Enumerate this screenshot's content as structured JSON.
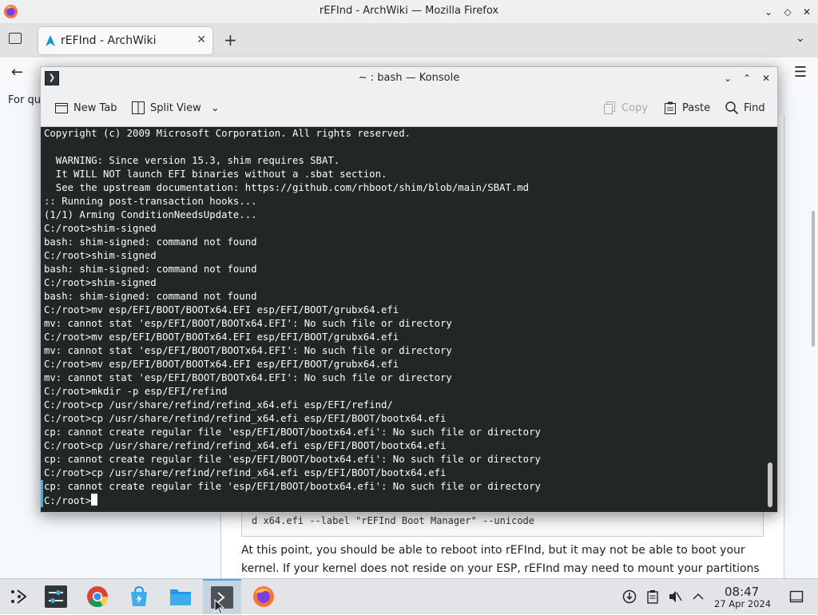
{
  "firefox": {
    "window_title": "rEFInd - ArchWiki — Mozilla Firefox",
    "tab_label": "rEFInd - ArchWiki",
    "notice_fragment": "For qu",
    "code_fragment": "d x64.efi --label \"rEFInd Boot Manager\" --unicode",
    "paragraph": "At this point, you should be able to reboot into rEFInd, but it may not be able to boot your kernel. If your kernel does not reside on your ESP, rEFInd may need to mount your partitions"
  },
  "konsole": {
    "window_title": "~ : bash — Konsole",
    "toolbar": {
      "new_tab": "New Tab",
      "split_view": "Split View",
      "copy": "Copy",
      "paste": "Paste",
      "find": "Find"
    },
    "terminal_lines": [
      "Copyright (c) 2009 Microsoft Corporation. All rights reserved.",
      "",
      "  WARNING: Since version 15.3, shim requires SBAT.",
      "  It WILL NOT launch EFI binaries without a .sbat section.",
      "  See the upstream documentation: https://github.com/rhboot/shim/blob/main/SBAT.md",
      ":: Running post-transaction hooks...",
      "(1/1) Arming ConditionNeedsUpdate...",
      "C:/root>shim-signed",
      "bash: shim-signed: command not found",
      "C:/root>shim-signed",
      "bash: shim-signed: command not found",
      "C:/root>shim-signed",
      "bash: shim-signed: command not found",
      "C:/root>mv esp/EFI/BOOT/BOOTx64.EFI esp/EFI/BOOT/grubx64.efi",
      "mv: cannot stat 'esp/EFI/BOOT/BOOTx64.EFI': No such file or directory",
      "C:/root>mv esp/EFI/BOOT/BOOTx64.EFI esp/EFI/BOOT/grubx64.efi",
      "mv: cannot stat 'esp/EFI/BOOT/BOOTx64.EFI': No such file or directory",
      "C:/root>mv esp/EFI/BOOT/BOOTx64.EFI esp/EFI/BOOT/grubx64.efi",
      "mv: cannot stat 'esp/EFI/BOOT/BOOTx64.EFI': No such file or directory",
      "C:/root>mkdir -p esp/EFI/refind",
      "C:/root>cp /usr/share/refind/refind_x64.efi esp/EFI/refind/",
      "C:/root>cp /usr/share/refind/refind_x64.efi esp/EFI/BOOT/bootx64.efi",
      "cp: cannot create regular file 'esp/EFI/BOOT/bootx64.efi': No such file or directory",
      "C:/root>cp /usr/share/refind/refind_x64.efi esp/EFI/BOOT/bootx64.efi",
      "cp: cannot create regular file 'esp/EFI/BOOT/bootx64.efi': No such file or directory",
      "C:/root>cp /usr/share/refind/refind_x64.efi esp/EFI/BOOT/bootx64.efi",
      "cp: cannot create regular file 'esp/EFI/BOOT/bootx64.efi': No such file or directory"
    ],
    "prompt": "C:/root>"
  },
  "taskbar": {
    "apps": [
      "app-launcher",
      "system-settings",
      "chrome",
      "discover",
      "dolphin",
      "konsole",
      "firefox"
    ],
    "time": "08:47",
    "date": "27 Apr 2024"
  },
  "colors": {
    "terminal_bg": "#232627",
    "terminal_fg": "#fcfcfc",
    "accent": "#3daee9",
    "chrome_bg": "#eff0f1"
  }
}
